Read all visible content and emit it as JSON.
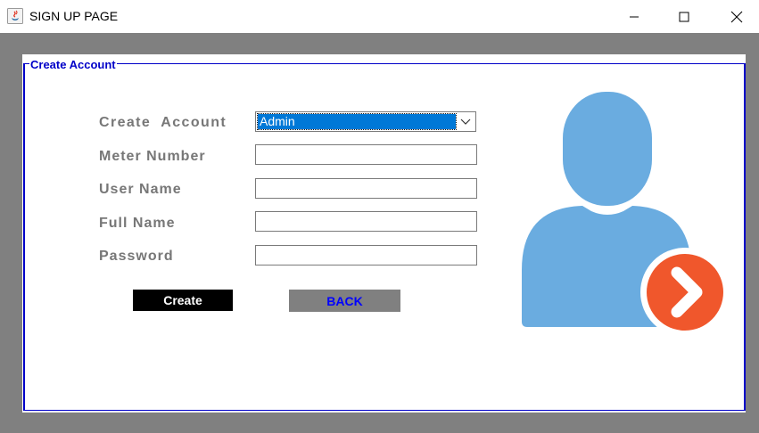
{
  "window": {
    "title": "SIGN UP PAGE",
    "app_icon": "java-icon",
    "controls": [
      "minimize-icon",
      "maximize-icon",
      "close-icon"
    ]
  },
  "panel": {
    "legend": "Create Account"
  },
  "form": {
    "create_account_label": "Create  Account",
    "create_account_selected": "Admin",
    "meter_number_label": "Meter Number",
    "meter_number_value": "",
    "user_name_label": "User Name",
    "user_name_value": "",
    "full_name_label": "Full Name",
    "full_name_value": "",
    "password_label": "Password",
    "password_value": ""
  },
  "buttons": {
    "create_label": "Create",
    "back_label": "BACK"
  },
  "graphic": {
    "icon": "user-arrow-icon"
  },
  "colors": {
    "frame": "#808080",
    "border_accent": "#0000c8",
    "label_text": "#777777",
    "select_highlight": "#0078d7",
    "user_silhouette": "#6aace0",
    "arrow_badge": "#f0572c",
    "back_text": "#0000ff"
  }
}
